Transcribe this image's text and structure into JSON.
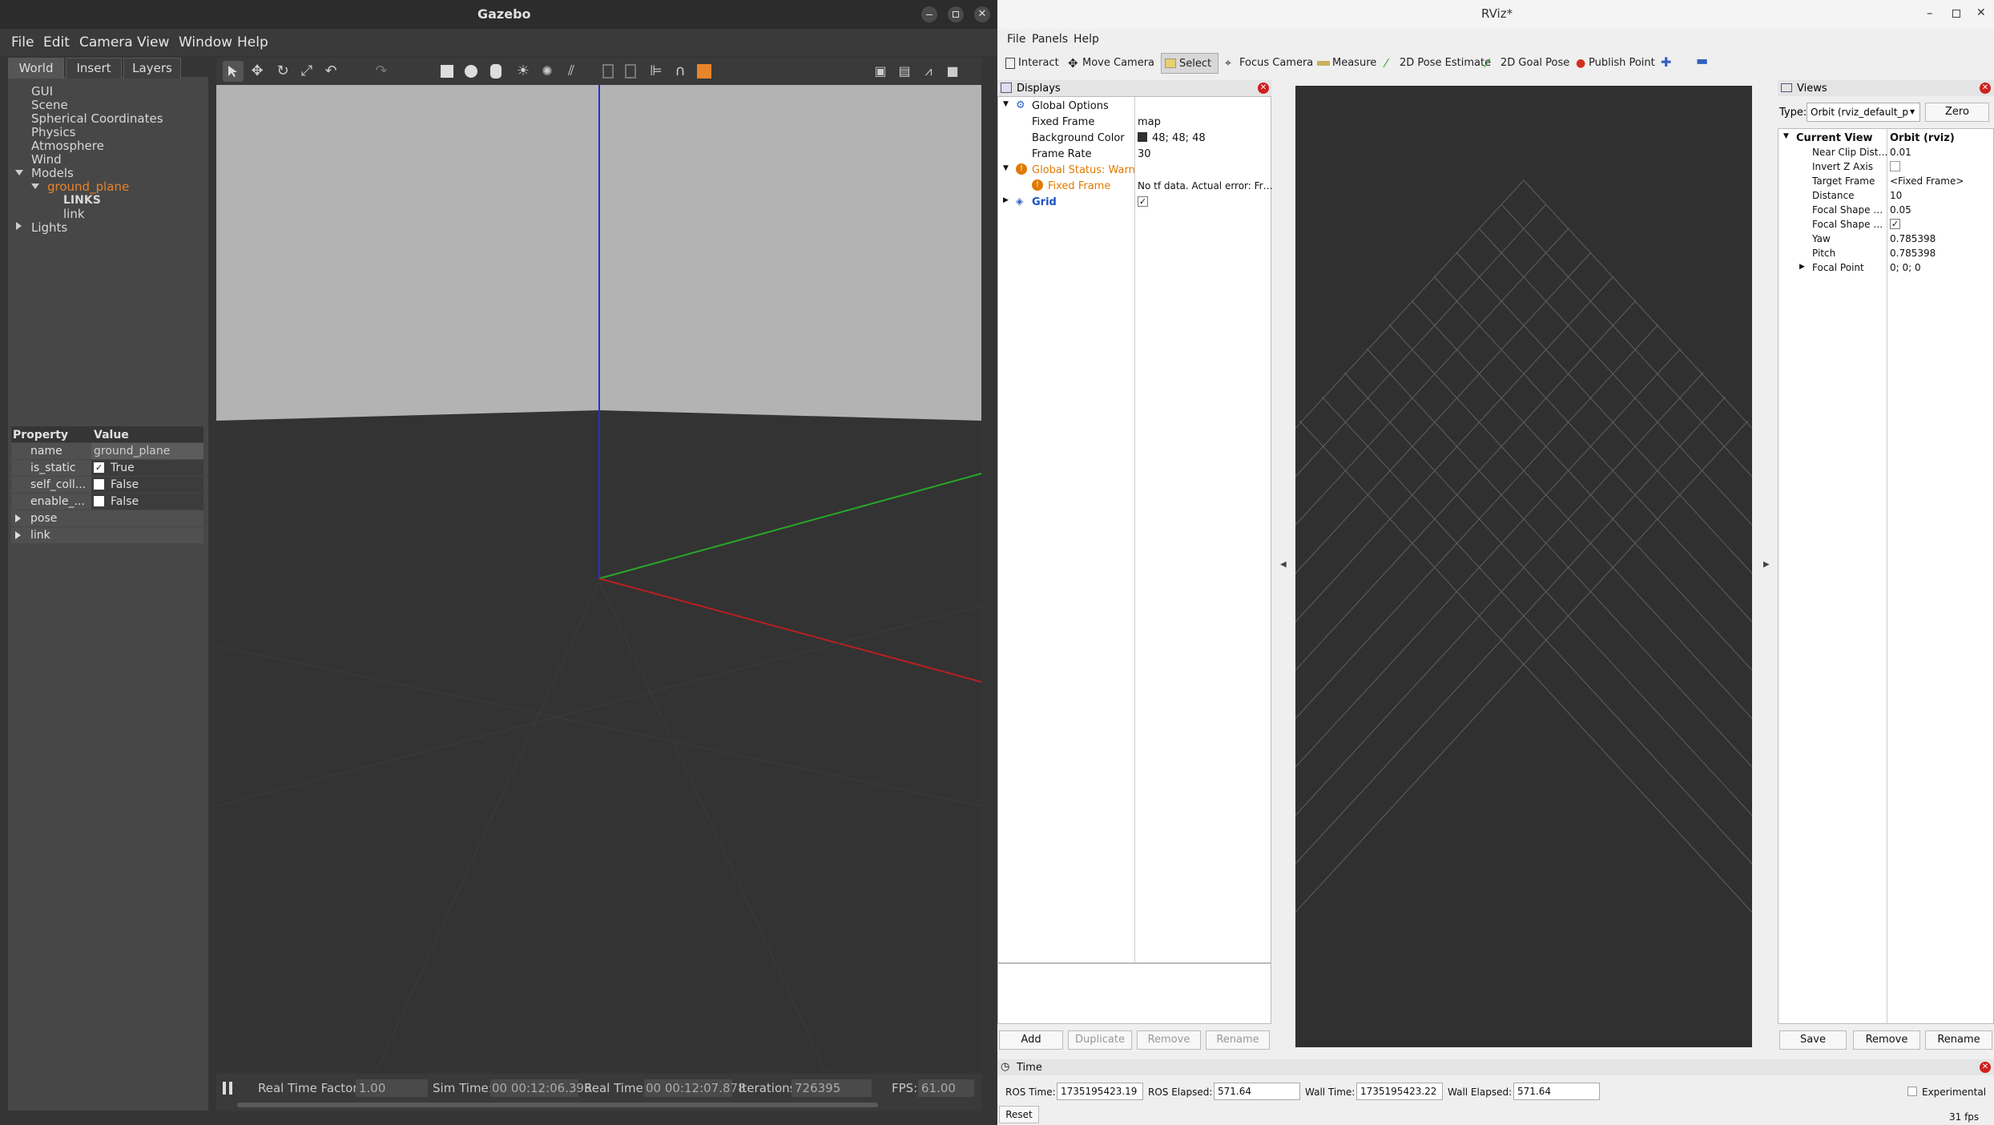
{
  "gazebo": {
    "title": "Gazebo",
    "menu": [
      "File",
      "Edit",
      "Camera",
      "View",
      "Window",
      "Help"
    ],
    "tabs": [
      "World",
      "Insert",
      "Layers"
    ],
    "tree": {
      "gui": "GUI",
      "scene": "Scene",
      "spherical": "Spherical Coordinates",
      "physics": "Physics",
      "atmosphere": "Atmosphere",
      "wind": "Wind",
      "models": "Models",
      "ground_plane": "ground_plane",
      "links_header": "LINKS",
      "link": "link",
      "lights": "Lights"
    },
    "props": {
      "header_property": "Property",
      "header_value": "Value",
      "rows": [
        {
          "name": "name",
          "value": "ground_plane",
          "check": false
        },
        {
          "name": "is_static",
          "value": "True",
          "check": true
        },
        {
          "name": "self_coll...",
          "value": "False",
          "check": false
        },
        {
          "name": "enable_...",
          "value": "False",
          "check": false
        }
      ],
      "pose": "pose",
      "link": "link"
    },
    "status": {
      "rtf_label": "Real Time Factor:",
      "rtf": "1.00",
      "sim_label": "Sim Time:",
      "sim": "00 00:12:06.395",
      "real_label": "Real Time:",
      "real": "00 00:12:07.878",
      "iter_label": "Iterations:",
      "iter": "726395",
      "fps_label": "FPS:",
      "fps": "61.00"
    }
  },
  "rviz": {
    "title": "RViz*",
    "menu": [
      "File",
      "Panels",
      "Help"
    ],
    "tools": [
      "Interact",
      "Move Camera",
      "Select",
      "Focus Camera",
      "Measure",
      "2D Pose Estimate",
      "2D Goal Pose",
      "Publish Point"
    ],
    "displays": {
      "title": "Displays",
      "global_options": "Global Options",
      "fixed_frame_label": "Fixed Frame",
      "fixed_frame": "map",
      "bg_label": "Background Color",
      "bg": "48; 48; 48",
      "rate_label": "Frame Rate",
      "rate": "30",
      "status": "Global Status: Warn",
      "ff_warn": "Fixed Frame",
      "ff_warn_msg": "No tf data.  Actual error: Fr…",
      "grid": "Grid",
      "buttons": [
        "Add",
        "Duplicate",
        "Remove",
        "Rename"
      ]
    },
    "views": {
      "title": "Views",
      "type_label": "Type:",
      "type": "Orbit (rviz_default_p",
      "zero": "Zero",
      "current_view": "Current View",
      "current_view_value": "Orbit (rviz)",
      "rows": [
        {
          "name": "Near Clip Dist…",
          "value": "0.01"
        },
        {
          "name": "Invert Z Axis",
          "value": ""
        },
        {
          "name": "Target Frame",
          "value": "<Fixed Frame>"
        },
        {
          "name": "Distance",
          "value": "10"
        },
        {
          "name": "Focal Shape …",
          "value": "0.05"
        },
        {
          "name": "Focal Shape …",
          "value": ""
        },
        {
          "name": "Yaw",
          "value": "0.785398"
        },
        {
          "name": "Pitch",
          "value": "0.785398"
        },
        {
          "name": "Focal Point",
          "value": "0; 0; 0"
        }
      ],
      "buttons": [
        "Save",
        "Remove",
        "Rename"
      ]
    },
    "time": {
      "title": "Time",
      "ros_time_label": "ROS Time:",
      "ros_time": "1735195423.19",
      "ros_elapsed_label": "ROS Elapsed:",
      "ros_elapsed": "571.64",
      "wall_time_label": "Wall Time:",
      "wall_time": "1735195423.22",
      "wall_elapsed_label": "Wall Elapsed:",
      "wall_elapsed": "571.64",
      "experimental": "Experimental",
      "reset": "Reset",
      "fps": "31 fps"
    },
    "colors": {
      "warn": "#e07a00",
      "link": "#1c4fc4"
    }
  }
}
